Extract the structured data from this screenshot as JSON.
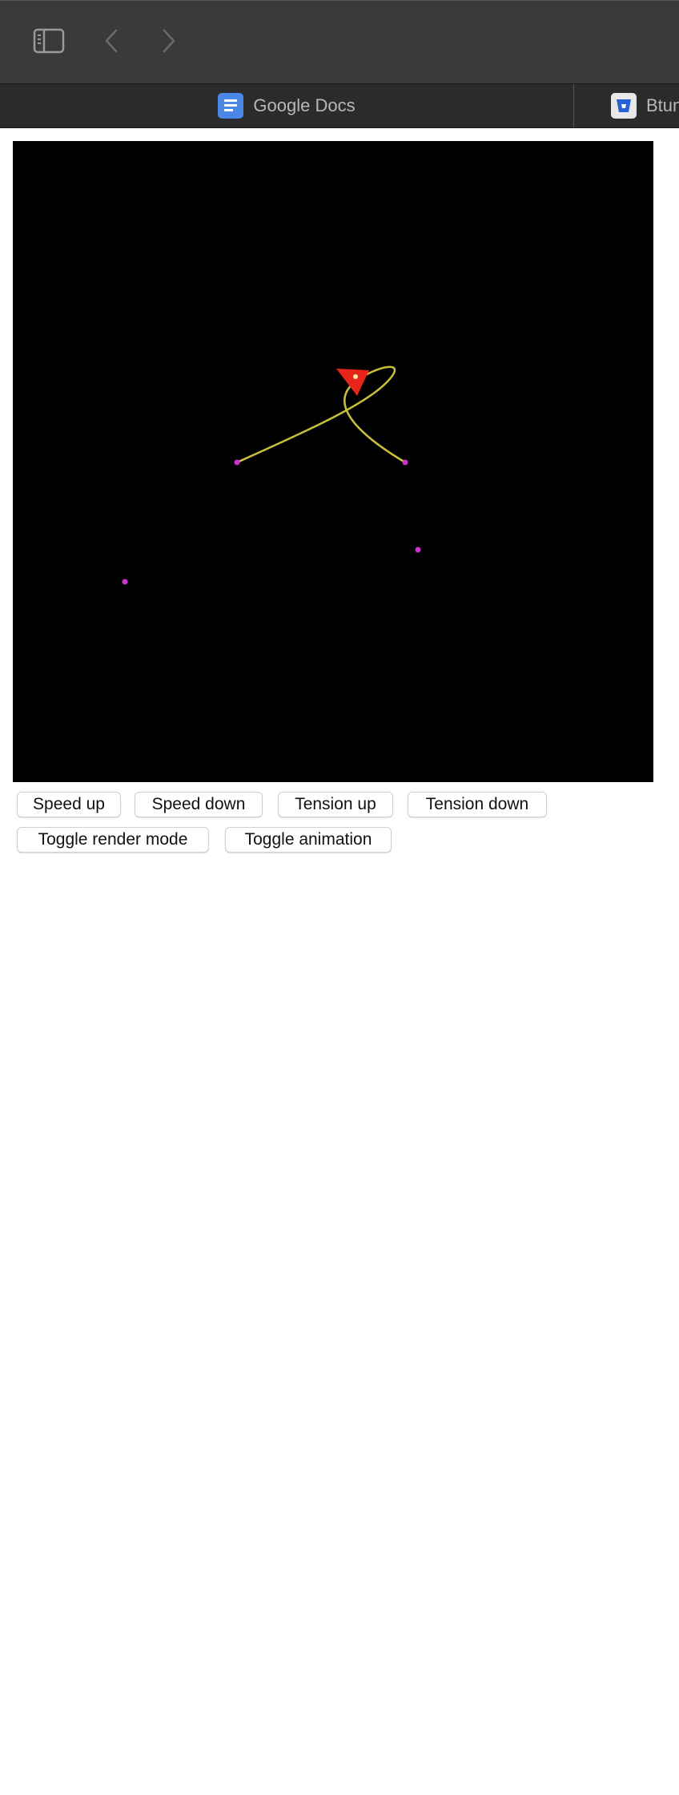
{
  "browser": {
    "toolbar": {
      "sidebar_icon": "sidebar-icon",
      "back_icon": "chevron-left-icon",
      "forward_icon": "chevron-right-icon"
    },
    "tabs": [
      {
        "label": "Google Docs",
        "icon": "google-docs-icon",
        "icon_color": "#4a86e8"
      },
      {
        "label": "Btun",
        "icon": "bitbucket-icon",
        "icon_color": "#2462d6"
      }
    ]
  },
  "canvas": {
    "background": "#000000",
    "curve_color": "#c8c03a",
    "point_color": "#cc33cc",
    "marker_color": "#e8251b"
  },
  "controls": {
    "speed_up": "Speed up",
    "speed_down": "Speed down",
    "tension_up": "Tension up",
    "tension_down": "Tension down",
    "toggle_render_mode": "Toggle render mode",
    "toggle_animation": "Toggle animation"
  }
}
